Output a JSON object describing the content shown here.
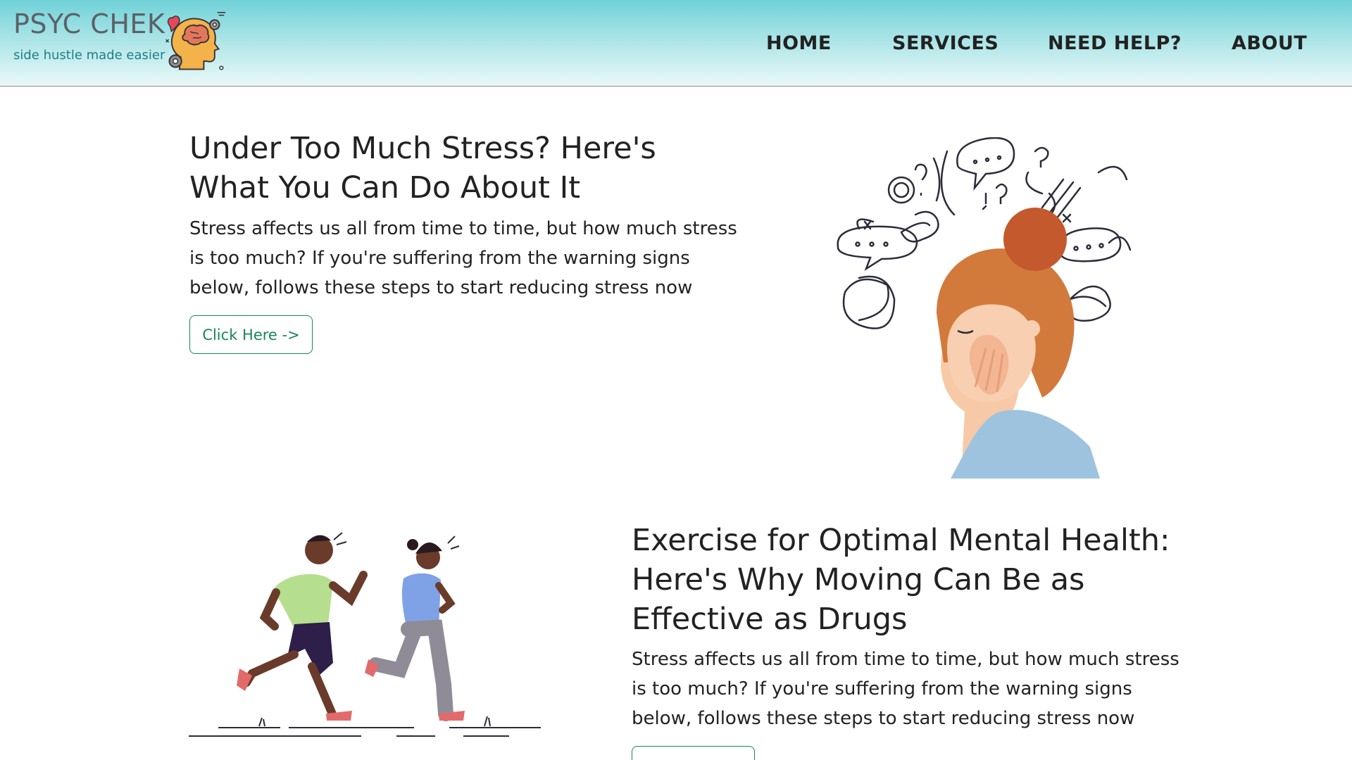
{
  "brand": {
    "name": "PSYC CHEK",
    "tagline": "side hustle made easier"
  },
  "nav": {
    "items": [
      "HOME",
      "SERVICES",
      "NEED HELP?",
      "ABOUT"
    ]
  },
  "articles": [
    {
      "title_line1": "Under Too Much Stress? Here's",
      "title_line2": "What You Can Do About It",
      "desc_line1": "Stress affects us all from time to time, but how much stress",
      "desc_line2": "is too much? If you're suffering from the warning signs",
      "desc_line3": "below, follows these steps to start reducing stress now",
      "button": "Click Here ->"
    },
    {
      "title_line1": "Exercise for Optimal Mental Health:",
      "title_line2": "Here's Why Moving Can Be as",
      "title_line3": "Effective as Drugs",
      "desc_line1": "Stress affects us all from time to time, but how much stress",
      "desc_line2": "is too much? If you're suffering from the warning signs",
      "desc_line3": "below, follows these steps to start reducing stress now"
    }
  ],
  "colors": {
    "accent": "#198754",
    "header_top": "#70d2d8",
    "header_bottom": "#eaf8f8",
    "tagline": "#1d7f86"
  }
}
